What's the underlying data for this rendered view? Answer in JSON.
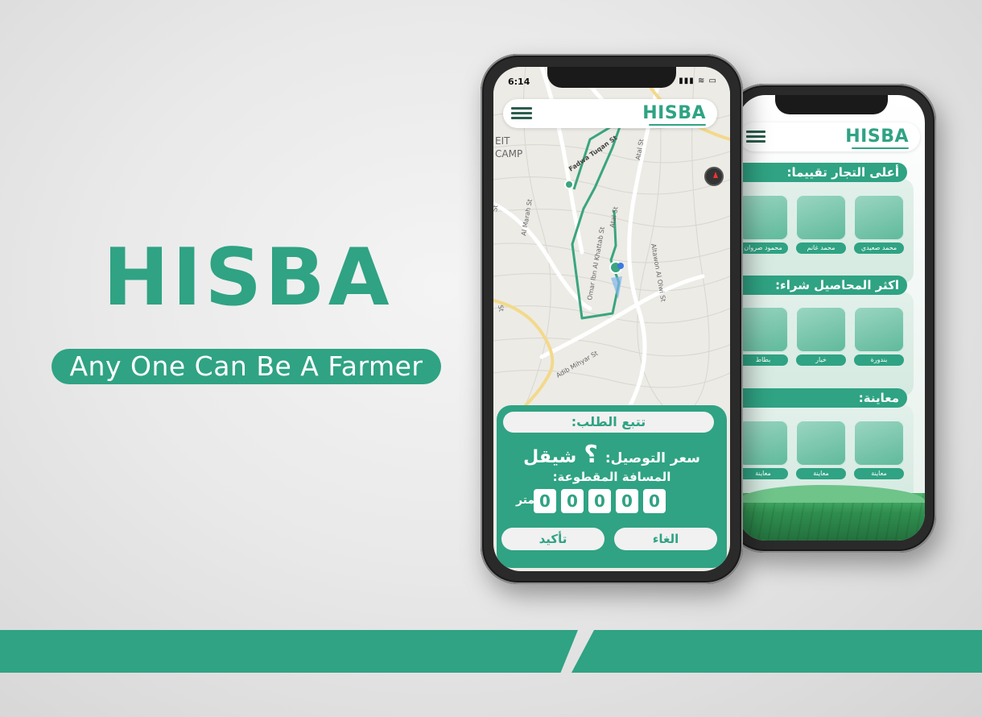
{
  "brand": {
    "title": "HISBA",
    "tagline": "Any One Can Be A Farmer"
  },
  "front_phone": {
    "status": {
      "time": "6:14",
      "icons": "▮▮▮ ≋ ▭"
    },
    "header": {
      "logo": "HISBA",
      "menu_icon": "hamburger-icon"
    },
    "map": {
      "labels": [
        "EIT",
        "CAMP",
        "Al Marah St",
        "Omar Ibn Al Khattab St",
        "Atal St",
        "Altawon Al Olwi St",
        "Adib Mihyar St",
        "Fadwa Tuqan St",
        "Atal St",
        "St",
        "St"
      ]
    },
    "panel": {
      "title": "تتبع الطلب:",
      "price_label": "سعر التوصيل:",
      "price_value": "؟",
      "price_currency": "شيقل",
      "distance_label": "المسافة المقطوعة:",
      "distance_digits": [
        "0",
        "0",
        "0",
        "0",
        "0"
      ],
      "distance_unit": "متر",
      "cancel_label": "الغاء",
      "confirm_label": "تأكيد"
    }
  },
  "back_phone": {
    "header": {
      "logo": "HISBA",
      "menu_icon": "hamburger-icon"
    },
    "sections": [
      {
        "title": "أعلى التجار تقييما:",
        "items": [
          "محمد صعيدي",
          "محمد غانم",
          "محمود صروان"
        ]
      },
      {
        "title": "اكثر المحاصيل شراء:",
        "items": [
          "بندورة",
          "خيار",
          "بطاط"
        ]
      },
      {
        "title": "معاينة:",
        "items": [
          "معاينة",
          "معاينة",
          "معاينة"
        ]
      }
    ]
  },
  "colors": {
    "accent": "#2fa383",
    "panel_light": "#f1f1f1",
    "map_background": "#ecebe6",
    "route": "#3aa57f"
  }
}
